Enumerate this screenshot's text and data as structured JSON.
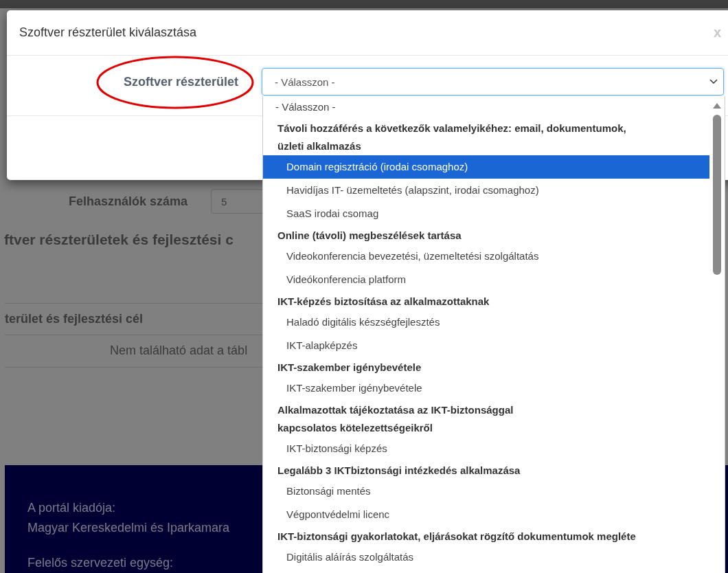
{
  "page": {
    "users_label": "Felhasználók száma",
    "users_value": "5",
    "section_heading": "ftver részterületek és fejlesztési c",
    "table": {
      "columns": [
        "terület és fejlesztési cél"
      ],
      "empty_message": "Nem található adat a tábl"
    },
    "footer": [
      "A portál kiadója:\nMagyar Kereskedelmi és Iparkamara",
      "Felelős szervezeti egység:"
    ]
  },
  "dialog": {
    "title": "Szoftver részterület kiválasztása",
    "close": "x",
    "field_label": "Szoftver részterület",
    "field_highlighted": true,
    "select": {
      "value": "- Válasszon -",
      "expanded": true
    },
    "options": [
      {
        "kind": "option",
        "label": "- Válasszon -",
        "selected": false
      },
      {
        "kind": "group",
        "label": "Távoli hozzáférés a következők valamelyikéhez: email, dokumentumok,\nüzleti alkalmazás"
      },
      {
        "kind": "option",
        "label": "Domain regisztráció (irodai csomaghoz)",
        "selected": true
      },
      {
        "kind": "option",
        "label": "Havidíjas IT- üzemeltetés (alapszint, irodai csomaghoz)",
        "selected": false
      },
      {
        "kind": "option",
        "label": "SaaS irodai csomag",
        "selected": false
      },
      {
        "kind": "group",
        "label": "Online (távoli) megbeszélések tartása"
      },
      {
        "kind": "option",
        "label": "Videokonferencia bevezetési, üzemeltetési szolgáltatás",
        "selected": false
      },
      {
        "kind": "option",
        "label": "Videókonferencia platform",
        "selected": false
      },
      {
        "kind": "group",
        "label": "IKT-képzés biztosítása az alkalmazottaknak"
      },
      {
        "kind": "option",
        "label": "Haladó digitális készségfejlesztés",
        "selected": false
      },
      {
        "kind": "option",
        "label": "IKT-alapképzés",
        "selected": false
      },
      {
        "kind": "group",
        "label": "IKT-szakember igénybevétele"
      },
      {
        "kind": "option",
        "label": "IKT-szakember igénybevétele",
        "selected": false
      },
      {
        "kind": "group",
        "label": "Alkalmazottak tájékoztatása az IKT-biztonsággal\nkapcsolatos kötelezettségeikről"
      },
      {
        "kind": "option",
        "label": "IKT-biztonsági képzés",
        "selected": false
      },
      {
        "kind": "group",
        "label": "Legalább 3 IKTbiztonsági intézkedés alkalmazása"
      },
      {
        "kind": "option",
        "label": "Biztonsági mentés",
        "selected": false
      },
      {
        "kind": "option",
        "label": "Végpontvédelmi licenc",
        "selected": false
      },
      {
        "kind": "group",
        "label": "IKT-biztonsági gyakorlatokat, eljárásokat rögzítő dokumentumok megléte"
      },
      {
        "kind": "option",
        "label": "Digitális aláírás szolgáltatás",
        "selected": false
      }
    ]
  }
}
